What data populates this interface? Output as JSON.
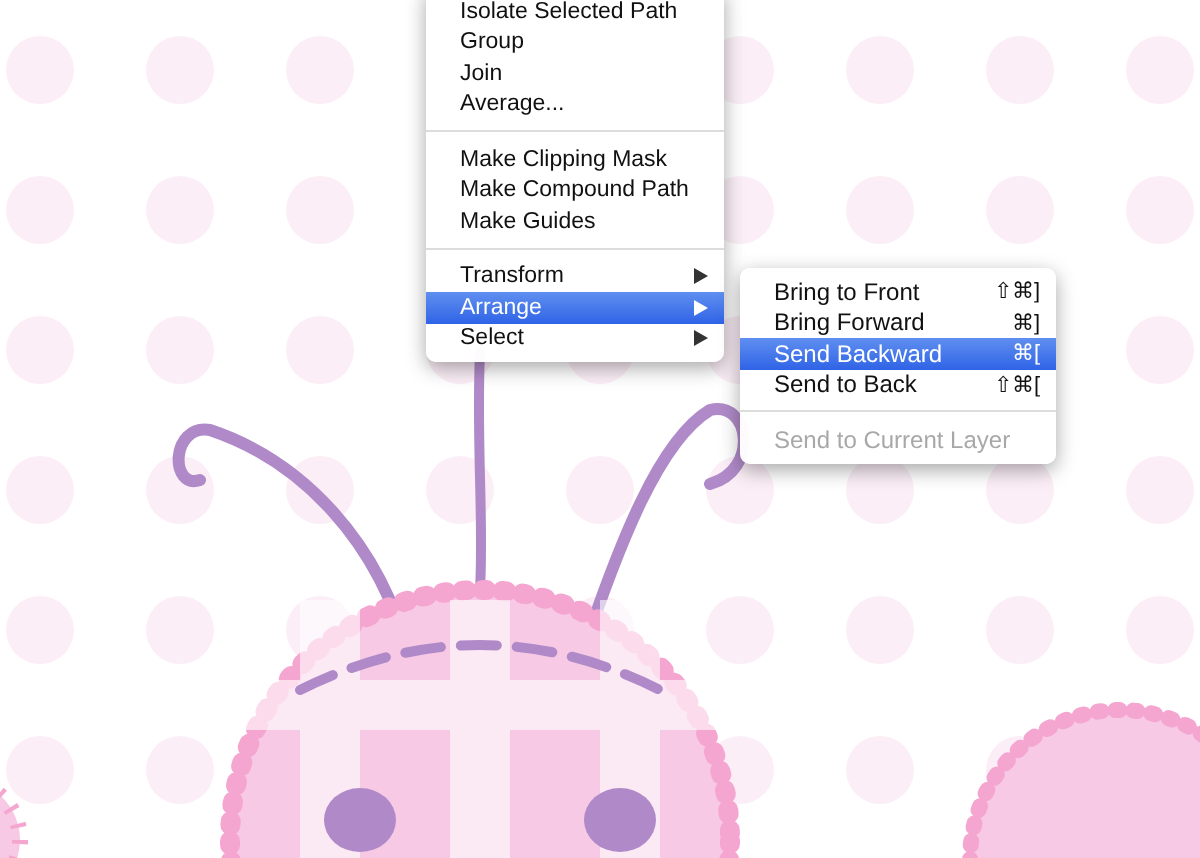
{
  "context_menu": {
    "sections": [
      [
        {
          "label": "Isolate Selected Path",
          "submenu": false,
          "selected": false
        },
        {
          "label": "Group",
          "submenu": false,
          "selected": false
        },
        {
          "label": "Join",
          "submenu": false,
          "selected": false
        },
        {
          "label": "Average...",
          "submenu": false,
          "selected": false
        }
      ],
      [
        {
          "label": "Make Clipping Mask",
          "submenu": false,
          "selected": false
        },
        {
          "label": "Make Compound Path",
          "submenu": false,
          "selected": false
        },
        {
          "label": "Make Guides",
          "submenu": false,
          "selected": false
        }
      ],
      [
        {
          "label": "Transform",
          "submenu": true,
          "selected": false
        },
        {
          "label": "Arrange",
          "submenu": true,
          "selected": true
        },
        {
          "label": "Select",
          "submenu": true,
          "selected": false
        }
      ]
    ]
  },
  "arrange_submenu": {
    "sections": [
      [
        {
          "label": "Bring to Front",
          "shortcut": "⇧⌘]",
          "selected": false,
          "disabled": false
        },
        {
          "label": "Bring Forward",
          "shortcut": "⌘]",
          "selected": false,
          "disabled": false
        },
        {
          "label": "Send Backward",
          "shortcut": "⌘[",
          "selected": true,
          "disabled": false
        },
        {
          "label": "Send to Back",
          "shortcut": "⇧⌘[",
          "selected": false,
          "disabled": false
        }
      ],
      [
        {
          "label": "Send to Current Layer",
          "selected": false,
          "disabled": true
        }
      ]
    ]
  }
}
